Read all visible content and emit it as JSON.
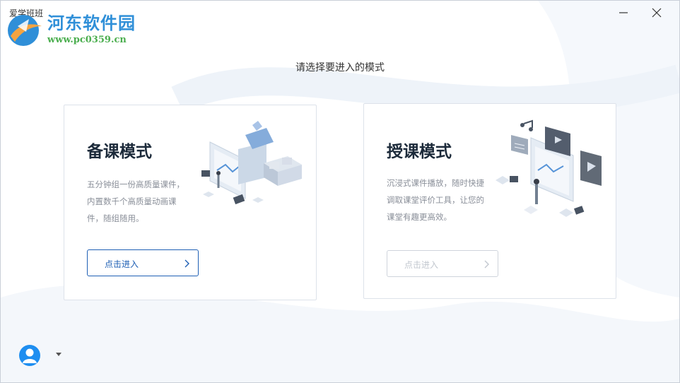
{
  "window": {
    "title": "爱学班班",
    "minimize_icon": "minimize-icon",
    "close_icon": "close-icon"
  },
  "watermark": {
    "name": "河东软件园",
    "url": "www.pc0359.cn"
  },
  "prompt": "请选择要进入的模式",
  "modes": [
    {
      "title": "备课模式",
      "description": "五分钟组一份高质量课件，内置数千个高质量动画课件，随组随用。",
      "button_label": "点击进入",
      "enabled": true
    },
    {
      "title": "授课模式",
      "description": "沉浸式课件播放，随时快捷调取课堂评价工具，让您的课堂有趣更高效。",
      "button_label": "点击进入",
      "enabled": false
    }
  ],
  "user": {
    "avatar_icon": "user-avatar-icon",
    "menu_icon": "caret-down-icon"
  },
  "colors": {
    "accent": "#1e5fb4",
    "avatar": "#1e8ef0",
    "disabled": "#c2c7cf"
  }
}
